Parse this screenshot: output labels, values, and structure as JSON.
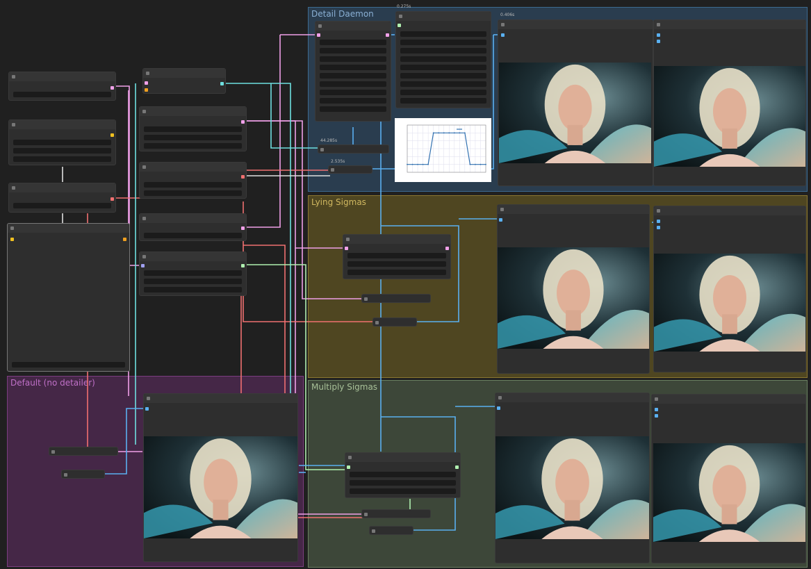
{
  "groups": {
    "detail_daemon": {
      "title": "Detail Daemon",
      "color": "#335577"
    },
    "lying_sigmas": {
      "title": "Lying Sigmas",
      "color": "#776622"
    },
    "default_no_detailer": {
      "title": "Default (no detailer)",
      "color": "#6a2e6e"
    },
    "multiply_sigmas": {
      "title": "Multiply Sigmas",
      "color": "#5a6e52"
    }
  },
  "timings": {
    "t1": "0.275s",
    "t2": "0.406s",
    "t3": "44.285s",
    "t4": "2.535s"
  },
  "colors": {
    "wire_blue": "#5ab0f0",
    "wire_cyan": "#6ee0e0",
    "wire_pink": "#f0a0e8",
    "wire_red": "#f07070",
    "wire_green": "#b0f0b0",
    "wire_white": "#e0e0e0",
    "canvas_bg": "#202020",
    "node_bg": "#2e2e2e"
  },
  "chart_data": {
    "type": "line",
    "title": "",
    "series": [
      {
        "name": "",
        "values": [
          0.0,
          0.0,
          0.0,
          0.0,
          0.0,
          0.4,
          0.4,
          0.4,
          0.4,
          0.4,
          0.4,
          0.4,
          0.0,
          0.0,
          0.0,
          0.0
        ]
      }
    ],
    "ylim": [
      -0.1,
      0.5
    ],
    "grid": true,
    "legend": "top-right"
  }
}
